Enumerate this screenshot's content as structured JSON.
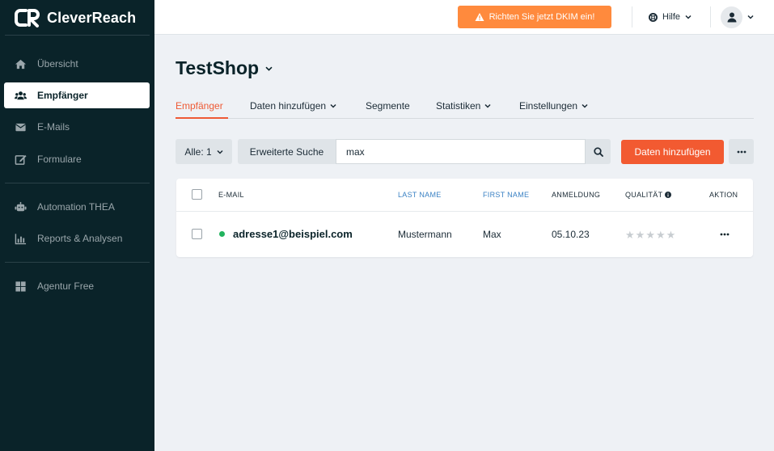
{
  "app": {
    "brand": "CleverReach"
  },
  "sidebar": {
    "items": [
      {
        "label": "Übersicht",
        "icon": "home-icon"
      },
      {
        "label": "Empfänger",
        "icon": "users-icon",
        "active": true
      },
      {
        "label": "E-Mails",
        "icon": "mail-icon"
      },
      {
        "label": "Formulare",
        "icon": "form-edit-icon"
      },
      {
        "label": "Automation THEA",
        "icon": "robot-icon"
      },
      {
        "label": "Reports & Analysen",
        "icon": "bar-chart-icon"
      },
      {
        "label": "Agentur Free",
        "icon": "grid-icon"
      }
    ]
  },
  "topbar": {
    "dkim_label": "Richten Sie jetzt DKIM ein!",
    "help_label": "Hilfe"
  },
  "page": {
    "title": "TestShop"
  },
  "tabs": [
    {
      "label": "Empfänger",
      "active": true
    },
    {
      "label": "Daten hinzufügen",
      "has_menu": true
    },
    {
      "label": "Segmente"
    },
    {
      "label": "Statistiken",
      "has_menu": true
    },
    {
      "label": "Einstellungen",
      "has_menu": true
    }
  ],
  "search": {
    "filter_label": "Alle: 1",
    "advanced_label": "Erweiterte Suche",
    "value": "max",
    "add_label": "Daten hinzufügen"
  },
  "table": {
    "columns": {
      "email": "E-MAIL",
      "last_name": "LAST NAME",
      "first_name": "FIRST NAME",
      "signup": "ANMELDUNG",
      "quality": "QUALITÄT",
      "action": "AKTION"
    },
    "rows": [
      {
        "email": "adresse1@beispiel.com",
        "last_name": "Mustermann",
        "first_name": "Max",
        "signup": "05.10.23",
        "quality": 0,
        "status": "active"
      }
    ]
  },
  "colors": {
    "sidebar_bg": "#0a2329",
    "accent": "#f25a31",
    "warning": "#ff8a3d",
    "link": "#3b82c4",
    "status_active": "#22b35e"
  }
}
